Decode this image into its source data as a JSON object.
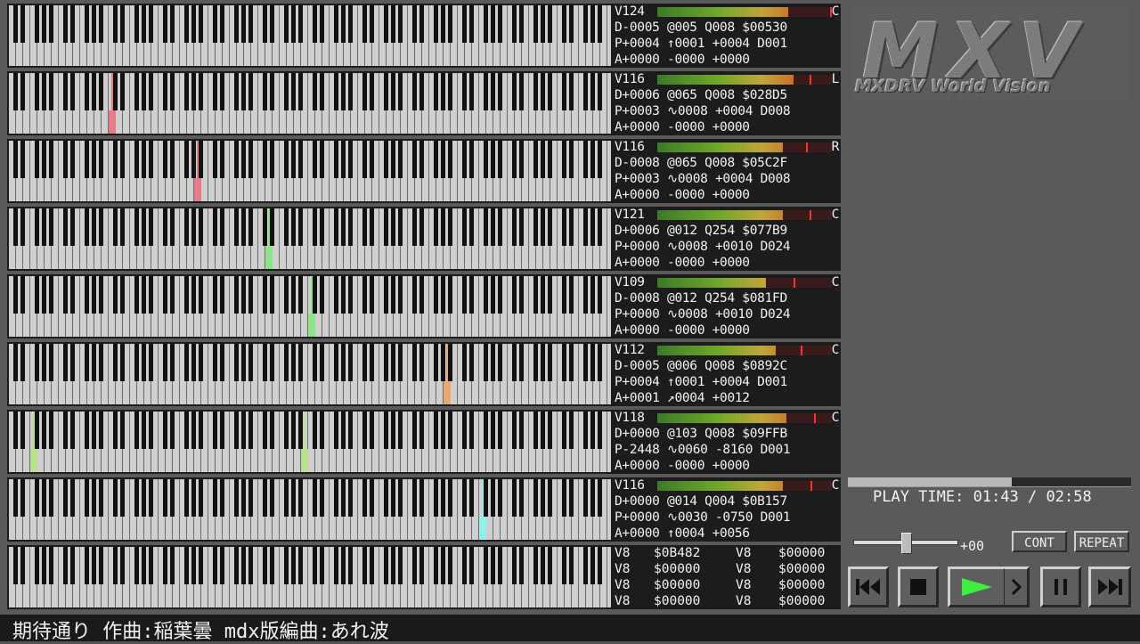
{
  "logo": {
    "mark": "MXV",
    "subtitle": "MXDRV World Vision"
  },
  "tracks": [
    {
      "vol": "V124",
      "pan": "C",
      "l2": "D-0005 @005 Q008 $00530",
      "l3": "P+0004 ↑0001 +0004 D001",
      "l4": "A+0000 -0000 +0000",
      "level": 0.75,
      "peak": 0.99,
      "notes": []
    },
    {
      "vol": "V116",
      "pan": "L",
      "l2": "D+0006 @065 Q008 $028D5",
      "l3": "P+0003 ∿0008 +0004 D008",
      "l4": "A+0000 -0000 +0000",
      "level": 0.78,
      "peak": 0.87,
      "notes": [
        {
          "key": 14,
          "color": "#e87b8a"
        }
      ]
    },
    {
      "vol": "V116",
      "pan": "R",
      "l2": "D-0008 @065 Q008 $05C2F",
      "l3": "P+0003 ∿0008 +0004 D008",
      "l4": "A+0000 -0000 +0000",
      "level": 0.72,
      "peak": 0.85,
      "notes": [
        {
          "key": 26,
          "color": "#e87b8a"
        }
      ]
    },
    {
      "vol": "V121",
      "pan": "C",
      "l2": "D+0006 @012 Q254 $077B9",
      "l3": "P+0000 ∿0008 +0010 D024",
      "l4": "A+0000 -0000 +0000",
      "level": 0.72,
      "peak": 0.87,
      "notes": [
        {
          "key": 36,
          "color": "#8fe38a"
        }
      ]
    },
    {
      "vol": "V109",
      "pan": "C",
      "l2": "D-0008 @012 Q254 $081FD",
      "l3": "P+0000 ∿0008 +0010 D024",
      "l4": "A+0000 -0000 +0000",
      "level": 0.62,
      "peak": 0.78,
      "notes": [
        {
          "key": 42,
          "color": "#8fe38a"
        }
      ]
    },
    {
      "vol": "V112",
      "pan": "C",
      "l2": "D-0005 @006 Q008 $0892C",
      "l3": "P+0004 ↑0001 +0004 D001",
      "l4": "A+0001 ↗0004 +0012",
      "level": 0.68,
      "peak": 0.82,
      "notes": [
        {
          "key": 61,
          "color": "#e8a870"
        }
      ]
    },
    {
      "vol": "V118",
      "pan": "C",
      "l2": "D+0000 @103 Q008 $09FFB",
      "l3": "P-2448 ∿0060 -8160 D001",
      "l4": "A+0000 -0000 +0000",
      "level": 0.74,
      "peak": 0.9,
      "notes": [
        {
          "key": 3,
          "color": "#b9e08d"
        },
        {
          "key": 41,
          "color": "#b9e08d"
        }
      ]
    },
    {
      "vol": "V116",
      "pan": "C",
      "l2": "D+0000 @014 Q004 $0B157",
      "l3": "P+0000 ∿0030 -0750 D001",
      "l4": "A+0000 ↑0004 +0056",
      "level": 0.72,
      "peak": 0.88,
      "notes": [
        {
          "key": 66,
          "color": "#8ff0f0"
        }
      ]
    }
  ],
  "status": [
    [
      "V8",
      "$0B482",
      "V8",
      "$00000"
    ],
    [
      "V8",
      "$00000",
      "V8",
      "$00000"
    ],
    [
      "V8",
      "$00000",
      "V8",
      "$00000"
    ],
    [
      "V8",
      "$00000",
      "V8",
      "$00000"
    ]
  ],
  "playtime": {
    "label": "PLAY TIME:",
    "current": "01:43",
    "total": "02:58",
    "progress": 0.58
  },
  "volume": {
    "value": "+00",
    "level": 0.5
  },
  "buttons": {
    "cont": "CONT",
    "repeat": "REPEAT"
  },
  "transport": {
    "prev": "prev-track",
    "stop": "stop",
    "play": "play",
    "next_small": "step",
    "pause": "pause",
    "next": "next-track"
  },
  "title": "期待通り 作曲:稲葉曇 mdx版編曲:あれ波",
  "colors": {
    "play": "#3ef03e",
    "panel": "#5a5a5a"
  }
}
